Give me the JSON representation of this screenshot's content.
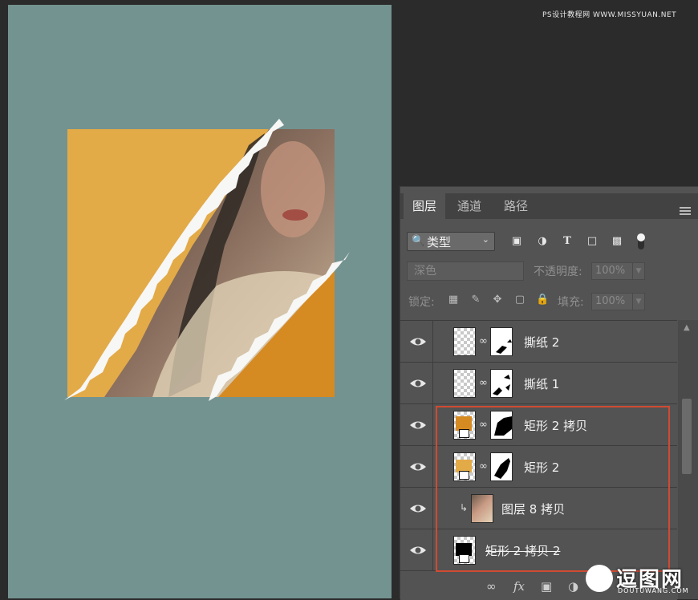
{
  "watermark_top": "PS设计教程网 WWW.MISSYUAN.NET",
  "tabs": [
    {
      "label": "图层",
      "active": true
    },
    {
      "label": "通道",
      "active": false
    },
    {
      "label": "路径",
      "active": false
    }
  ],
  "filter": {
    "type_label": "类型",
    "icons": [
      "image-filter-icon",
      "adjustment-filter-icon",
      "type-filter-icon",
      "shape-filter-icon",
      "smart-object-filter-icon"
    ]
  },
  "blend": {
    "mode": "深色",
    "opacity_label": "不透明度:",
    "opacity_value": "100%"
  },
  "lock": {
    "label": "锁定:",
    "fill_label": "填充:",
    "fill_value": "100%"
  },
  "layers": [
    {
      "name": "撕纸 2",
      "thumb": "transparent",
      "has_mask": true,
      "visible": true
    },
    {
      "name": "撕纸 1",
      "thumb": "transparent",
      "has_mask": true,
      "visible": true
    },
    {
      "name": "矩形 2 拷贝",
      "thumb": "orange-shape",
      "has_mask": true,
      "visible": true
    },
    {
      "name": "矩形 2",
      "thumb": "orange-shape",
      "has_mask": true,
      "visible": true
    },
    {
      "name": "图层 8 拷贝",
      "thumb": "photo",
      "has_mask": false,
      "clipped": true,
      "visible": true
    },
    {
      "name": "矩形 2 拷贝 2",
      "thumb": "black-shape",
      "has_mask": false,
      "visible": true
    }
  ],
  "bottom_bar": {
    "fx_label": "fx"
  },
  "watermark_badge": {
    "title": "逗图网",
    "subtitle": "DOUTUWANG.COM"
  },
  "colors": {
    "canvas_bg": "#739390",
    "orange_left": "#e3aa48",
    "orange_right": "#d68a22",
    "highlight": "#cf4b32",
    "panel_bg": "#535353"
  }
}
